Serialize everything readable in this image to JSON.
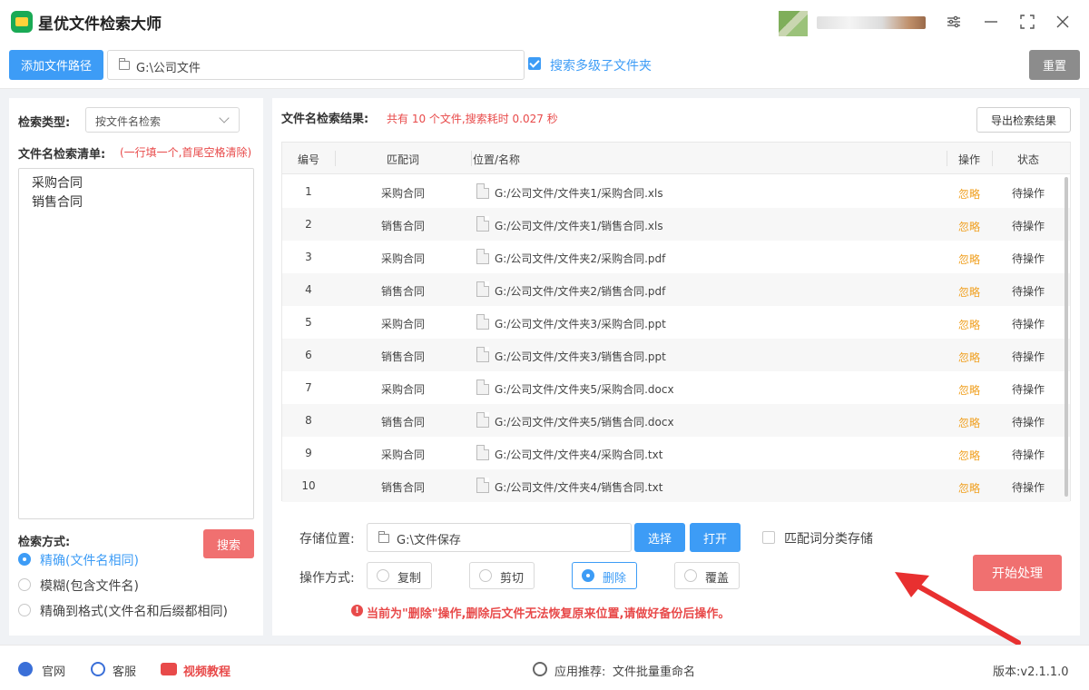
{
  "app": {
    "title": "星优文件检索大师"
  },
  "toolbar": {
    "add_path_label": "添加文件路径",
    "path_value": "G:\\公司文件",
    "subfolder_checked": true,
    "subfolder_label": "搜索多级子文件夹",
    "reset_label": "重置"
  },
  "left": {
    "search_type_label": "检索类型:",
    "search_type_value": "按文件名检索",
    "list_label": "文件名检索清单:",
    "list_hint": "(一行填一个,首尾空格清除)",
    "list_items": [
      "采购合同",
      "销售合同"
    ],
    "search_button": "搜索",
    "mode_label": "检索方式:",
    "modes": [
      {
        "label": "精确(文件名相同)",
        "selected": true
      },
      {
        "label": "模糊(包含文件名)",
        "selected": false
      },
      {
        "label": "精确到格式(文件名和后缀都相同)",
        "selected": false
      }
    ]
  },
  "results": {
    "title": "文件名检索结果:",
    "summary": "共有 10 个文件,搜索耗时 0.027 秒",
    "export_label": "导出检索结果",
    "columns": [
      "编号",
      "匹配词",
      "位置/名称",
      "操作",
      "状态"
    ],
    "rows": [
      {
        "no": "1",
        "keyword": "采购合同",
        "path": "G:/公司文件/文件夹1/采购合同.xls",
        "op": "忽略",
        "status": "待操作"
      },
      {
        "no": "2",
        "keyword": "销售合同",
        "path": "G:/公司文件/文件夹1/销售合同.xls",
        "op": "忽略",
        "status": "待操作"
      },
      {
        "no": "3",
        "keyword": "采购合同",
        "path": "G:/公司文件/文件夹2/采购合同.pdf",
        "op": "忽略",
        "status": "待操作"
      },
      {
        "no": "4",
        "keyword": "销售合同",
        "path": "G:/公司文件/文件夹2/销售合同.pdf",
        "op": "忽略",
        "status": "待操作"
      },
      {
        "no": "5",
        "keyword": "采购合同",
        "path": "G:/公司文件/文件夹3/采购合同.ppt",
        "op": "忽略",
        "status": "待操作"
      },
      {
        "no": "6",
        "keyword": "销售合同",
        "path": "G:/公司文件/文件夹3/销售合同.ppt",
        "op": "忽略",
        "status": "待操作"
      },
      {
        "no": "7",
        "keyword": "采购合同",
        "path": "G:/公司文件/文件夹5/采购合同.docx",
        "op": "忽略",
        "status": "待操作"
      },
      {
        "no": "8",
        "keyword": "销售合同",
        "path": "G:/公司文件/文件夹5/销售合同.docx",
        "op": "忽略",
        "status": "待操作"
      },
      {
        "no": "9",
        "keyword": "采购合同",
        "path": "G:/公司文件/文件夹4/采购合同.txt",
        "op": "忽略",
        "status": "待操作"
      },
      {
        "no": "10",
        "keyword": "销售合同",
        "path": "G:/公司文件/文件夹4/销售合同.txt",
        "op": "忽略",
        "status": "待操作"
      }
    ]
  },
  "storage": {
    "label": "存储位置:",
    "value": "G:\\文件保存",
    "select_label": "选择",
    "open_label": "打开",
    "classify_checked": false,
    "classify_label": "匹配词分类存储"
  },
  "operation": {
    "label": "操作方式:",
    "options": [
      {
        "label": "复制",
        "selected": false
      },
      {
        "label": "剪切",
        "selected": false
      },
      {
        "label": "删除",
        "selected": true
      },
      {
        "label": "覆盖",
        "selected": false
      }
    ],
    "start_label": "开始处理",
    "warning": "当前为\"删除\"操作,删除后文件无法恢复原来位置,请做好备份后操作。"
  },
  "footer": {
    "website": "官网",
    "support": "客服",
    "video": "视频教程",
    "recommend_label": "应用推荐:",
    "recommend_value": "文件批量重命名",
    "version": "版本:v2.1.1.0"
  },
  "colors": {
    "accent": "#3d9cf6",
    "danger": "#e84a4a",
    "warning": "#f0a020",
    "start": "#f07070"
  }
}
